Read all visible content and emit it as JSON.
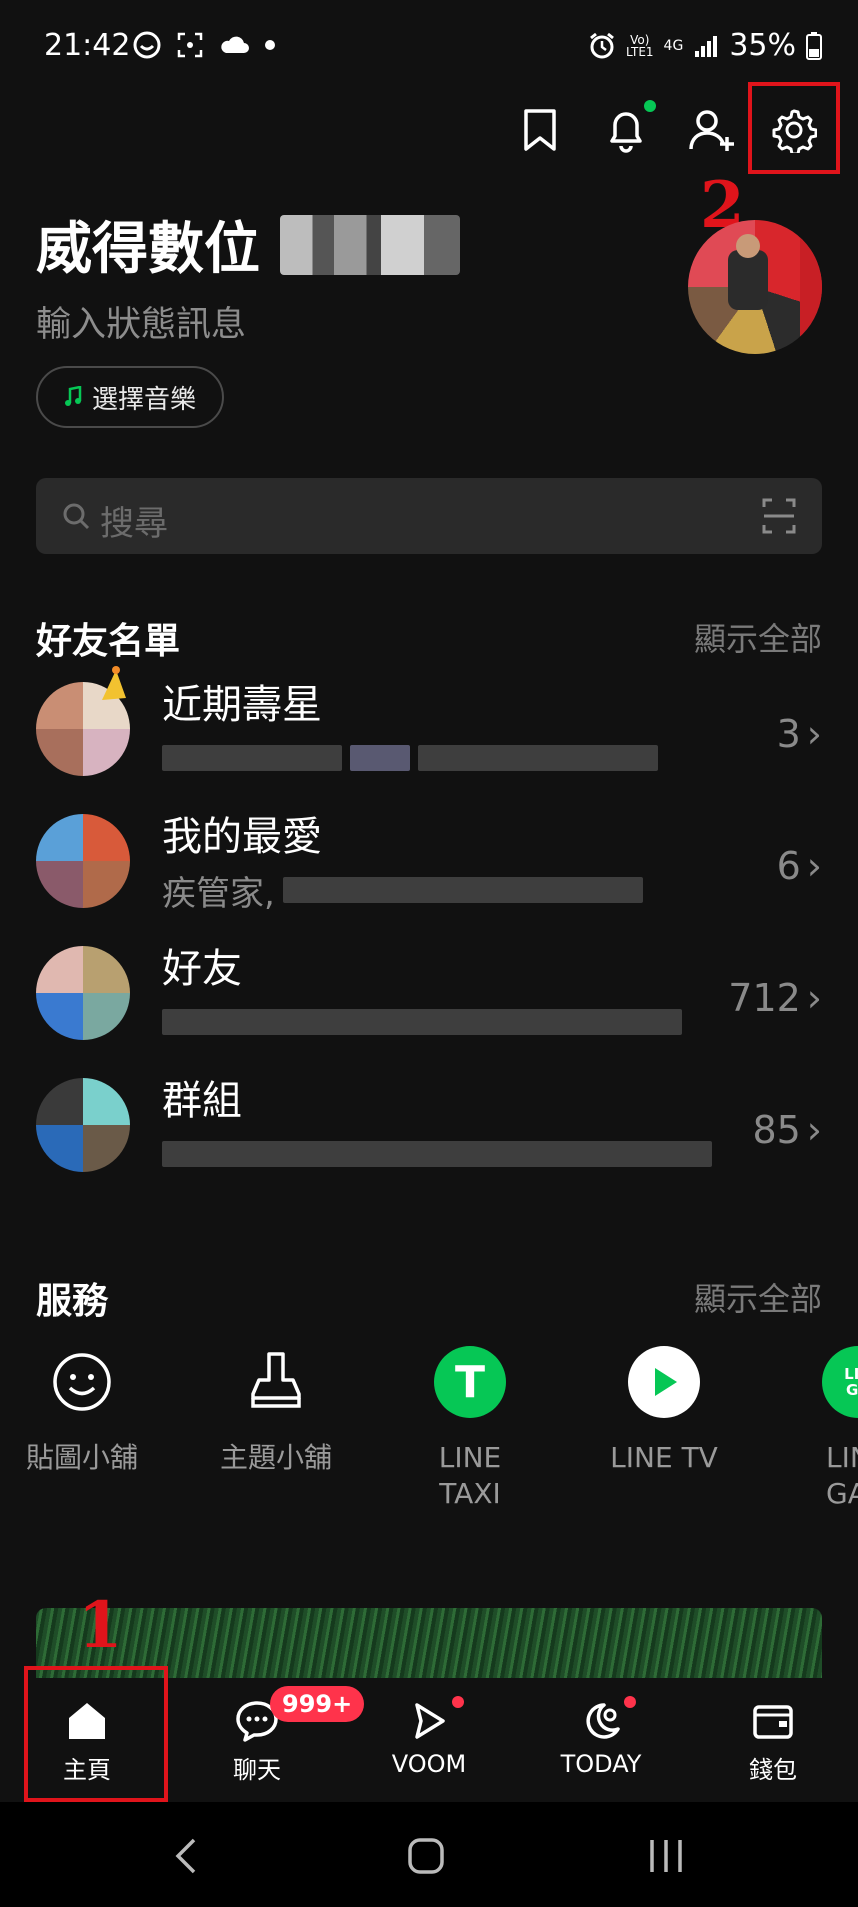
{
  "status_bar": {
    "time": "21:42",
    "network_top": "Vo)",
    "network_bottom": "LTE1",
    "network_type": "4G",
    "battery": "35%"
  },
  "top_actions": [
    "bookmark-icon",
    "bell-icon",
    "add-friend-icon",
    "settings-icon"
  ],
  "annotations": {
    "settings_step": "2",
    "home_step": "1",
    "highlight_color": "#e0141b"
  },
  "profile": {
    "name": "威得數位",
    "status_message": "輸入狀態訊息",
    "music_button": "選擇音樂"
  },
  "search": {
    "placeholder": "搜尋"
  },
  "friends_section": {
    "title": "好友名單",
    "show_all": "顯示全部",
    "rows": [
      {
        "title": "近期壽星",
        "subtitle": "",
        "count": "3"
      },
      {
        "title": "我的最愛",
        "subtitle": "疾管家,",
        "count": "6"
      },
      {
        "title": "好友",
        "subtitle": "",
        "count": "712"
      },
      {
        "title": "群組",
        "subtitle": "",
        "count": "85"
      }
    ]
  },
  "services_section": {
    "title": "服務",
    "show_all": "顯示全部",
    "items": [
      {
        "label": "貼圖小舖",
        "icon": "smiley-icon"
      },
      {
        "label": "主題小舖",
        "icon": "brush-icon"
      },
      {
        "label_line1": "LINE",
        "label_line2": "TAXI",
        "icon": "line-taxi-icon",
        "icon_letter": "T"
      },
      {
        "label": "LINE TV",
        "icon": "line-tv-icon"
      },
      {
        "label_line1": "LIN",
        "label_line2": "GA",
        "icon": "line-games-icon",
        "icon_text": "LIN GA"
      }
    ]
  },
  "bottom_nav": {
    "items": [
      {
        "label": "主頁",
        "icon": "home-icon"
      },
      {
        "label": "聊天",
        "icon": "chat-icon",
        "badge": "999+"
      },
      {
        "label": "VOOM",
        "icon": "voom-icon"
      },
      {
        "label": "TODAY",
        "icon": "today-icon"
      },
      {
        "label": "錢包",
        "icon": "wallet-icon"
      }
    ]
  },
  "colors": {
    "background": "#111111",
    "line_green": "#06c755",
    "badge_red": "#ff334b",
    "muted_text": "#8a8a8a"
  }
}
